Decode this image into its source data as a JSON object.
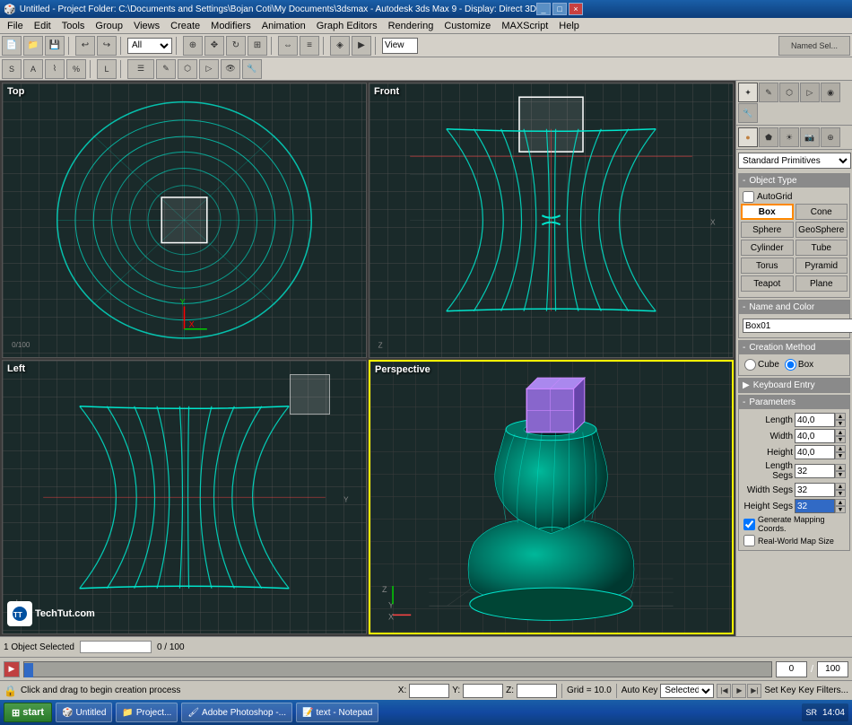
{
  "titlebar": {
    "title": "Untitled - Project Folder: C:\\Documents and Settings\\Bojan Coti\\My Documents\\3dsmax - Autodesk 3ds Max 9 - Display: Direct 3D",
    "icon": "🎲",
    "buttons": [
      "_",
      "□",
      "×"
    ]
  },
  "menubar": {
    "items": [
      "File",
      "Edit",
      "Tools",
      "Group",
      "Views",
      "Create",
      "Modifiers",
      "Animation",
      "Graph Editors",
      "Rendering",
      "Customize",
      "MAXScript",
      "Help"
    ]
  },
  "viewports": {
    "top_left": {
      "label": "Top",
      "active": false
    },
    "top_right": {
      "label": "Front",
      "active": false
    },
    "bottom_left": {
      "label": "Left",
      "active": false
    },
    "bottom_right": {
      "label": "Perspective",
      "active": true
    }
  },
  "right_panel": {
    "primitives_label": "Standard Primitives",
    "object_type_header": "Object Type",
    "autogrid_label": "AutoGrid",
    "buttons": [
      {
        "id": "box",
        "label": "Box",
        "active": true
      },
      {
        "id": "cone",
        "label": "Cone",
        "active": false
      },
      {
        "id": "sphere",
        "label": "Sphere",
        "active": false
      },
      {
        "id": "geosphere",
        "label": "GeoSphere",
        "active": false
      },
      {
        "id": "cylinder",
        "label": "Cylinder",
        "active": false
      },
      {
        "id": "tube",
        "label": "Tube",
        "active": false
      },
      {
        "id": "torus",
        "label": "Torus",
        "active": false
      },
      {
        "id": "pyramid",
        "label": "Pyramid",
        "active": false
      },
      {
        "id": "teapot",
        "label": "Teapot",
        "active": false
      },
      {
        "id": "plane",
        "label": "Plane",
        "active": false
      }
    ],
    "name_color_header": "Name and Color",
    "name_value": "Box01",
    "creation_method_header": "Creation Method",
    "cube_label": "Cube",
    "box_label": "Box",
    "keyboard_entry_header": "Keyboard Entry",
    "parameters_header": "Parameters",
    "length_label": "Length",
    "length_value": "40,0",
    "width_label": "Width",
    "width_value": "40,0",
    "height_label": "Height",
    "height_value": "40,0",
    "length_segs_label": "Length Segs",
    "length_segs_value": "32",
    "width_segs_label": "Width Segs",
    "width_segs_value": "32",
    "height_segs_label": "Height Segs",
    "height_segs_value": "32",
    "gen_mapping_label": "Generate Mapping Coords.",
    "real_world_label": "Real-World Map Size"
  },
  "status": {
    "objects_selected": "1 Object Selected",
    "hint": "Click and drag to begin creation process",
    "progress": "0 / 100"
  },
  "coords": {
    "x_label": "X:",
    "x_value": "",
    "y_label": "Y:",
    "y_value": "",
    "z_label": "Z:",
    "z_value": "",
    "grid_label": "Grid = 10.0",
    "auto_key_label": "Auto Key",
    "selected_label": "Selected",
    "set_key_label": "Set Key",
    "key_filters_label": "Key Filters..."
  },
  "taskbar": {
    "start_label": "start",
    "items": [
      "Untitled",
      "Project...",
      "Adobe Photoshop -...",
      "text - Notepad"
    ],
    "time": "14:04",
    "sr_indicator": "SR"
  },
  "toolbar": {
    "view_label": "View",
    "render_label": "Render",
    "select_filter": "All"
  }
}
